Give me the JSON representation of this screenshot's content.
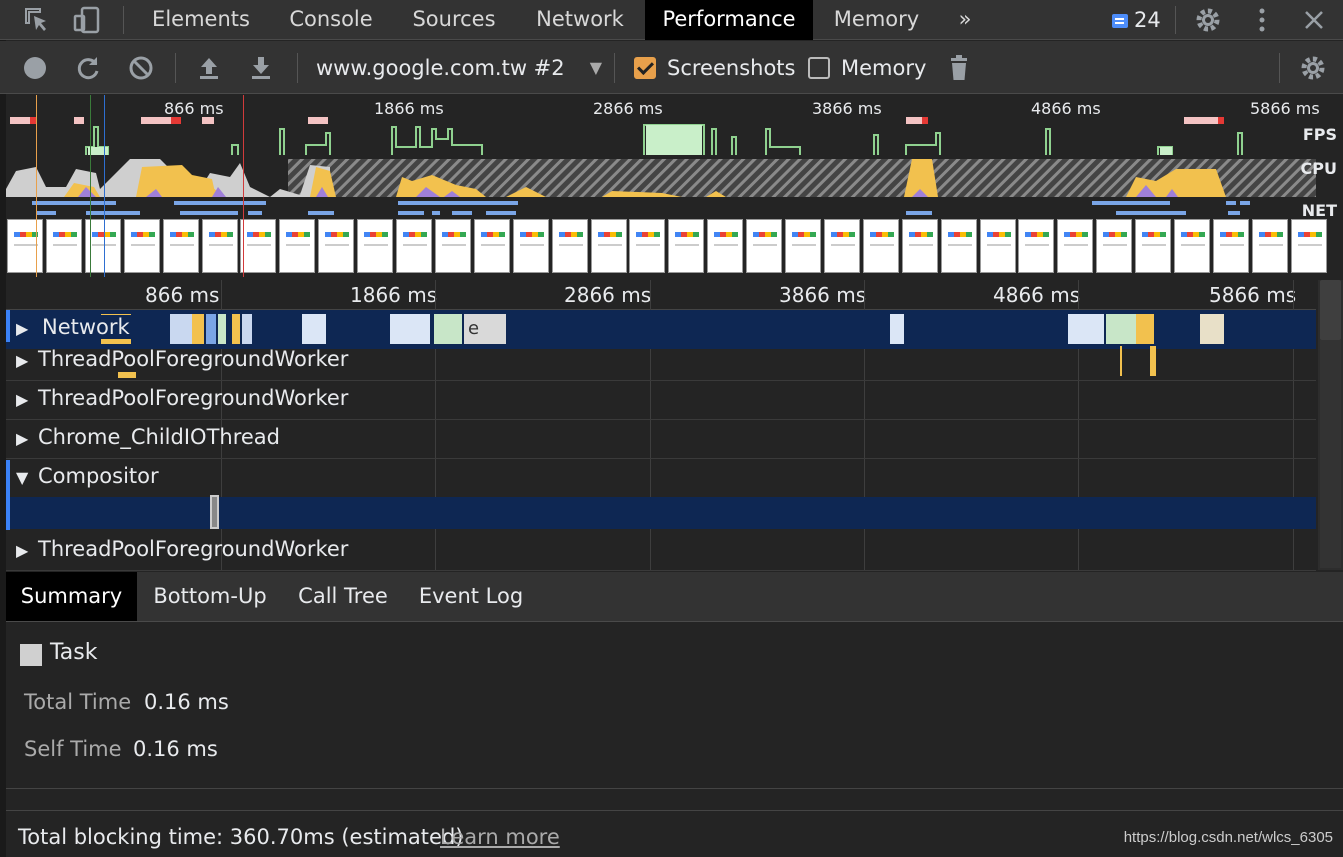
{
  "topbar": {
    "tabs": [
      {
        "label": "Elements",
        "active": false
      },
      {
        "label": "Console",
        "active": false
      },
      {
        "label": "Sources",
        "active": false
      },
      {
        "label": "Network",
        "active": false
      },
      {
        "label": "Performance",
        "active": true
      },
      {
        "label": "Memory",
        "active": false
      }
    ],
    "more_icon": "chevron-double-right-icon",
    "messages_count": "24",
    "icons": [
      "inspect-element-icon",
      "device-toolbar-icon",
      "settings-gear-icon",
      "more-vertical-icon",
      "close-icon"
    ]
  },
  "toolbar": {
    "profile_select": "www.google.com.tw #2",
    "screenshots_label": "Screenshots",
    "screenshots_checked": true,
    "memory_label": "Memory",
    "memory_checked": false,
    "icons": [
      "record-icon",
      "reload-icon",
      "clear-icon",
      "upload-icon",
      "download-icon",
      "trash-icon",
      "capture-settings-gear-icon"
    ]
  },
  "overview": {
    "ticks": [
      "866 ms",
      "1866 ms",
      "2866 ms",
      "3866 ms",
      "4866 ms",
      "5866 ms"
    ],
    "track_labels": {
      "fps": "FPS",
      "cpu": "CPU",
      "net": "NET"
    },
    "screenshot_thumb_text": "Google"
  },
  "main": {
    "ticks": [
      "866 ms",
      "1866 ms",
      "2866 ms",
      "3866 ms",
      "4866 ms",
      "5866 ms"
    ],
    "tracks": [
      {
        "name": "Network",
        "expanded": false,
        "selected": true
      },
      {
        "name": "ThreadPoolForegroundWorker",
        "expanded": false,
        "selected": false
      },
      {
        "name": "ThreadPoolForegroundWorker",
        "expanded": false,
        "selected": false
      },
      {
        "name": "Chrome_ChildIOThread",
        "expanded": false,
        "selected": false
      },
      {
        "name": "Compositor",
        "expanded": true,
        "selected": false
      },
      {
        "name": "ThreadPoolForegroundWorker",
        "expanded": false,
        "selected": false
      }
    ],
    "network_event_letter": "e"
  },
  "details": {
    "tabs": [
      {
        "label": "Summary",
        "active": true
      },
      {
        "label": "Bottom-Up",
        "active": false
      },
      {
        "label": "Call Tree",
        "active": false
      },
      {
        "label": "Event Log",
        "active": false
      }
    ],
    "task_title": "Task",
    "total_time_label": "Total Time",
    "total_time_value": "0.16 ms",
    "self_time_label": "Self Time",
    "self_time_value": "0.16 ms"
  },
  "footer": {
    "total_blocking_time": "Total blocking time: 360.70ms (estimated)",
    "learn_more": "Learn more",
    "watermark": "https://blog.csdn.net/wlcs_6305"
  },
  "colors": {
    "accent_blue": "#3b82f6",
    "selected_row": "#0e2753",
    "fps_green": "#9be19b",
    "cpu_yellow": "#f2c14e",
    "cpu_purple": "#9f7fd9",
    "net_blue": "#7aa5e6",
    "checkbox_orange": "#e8a04b"
  }
}
